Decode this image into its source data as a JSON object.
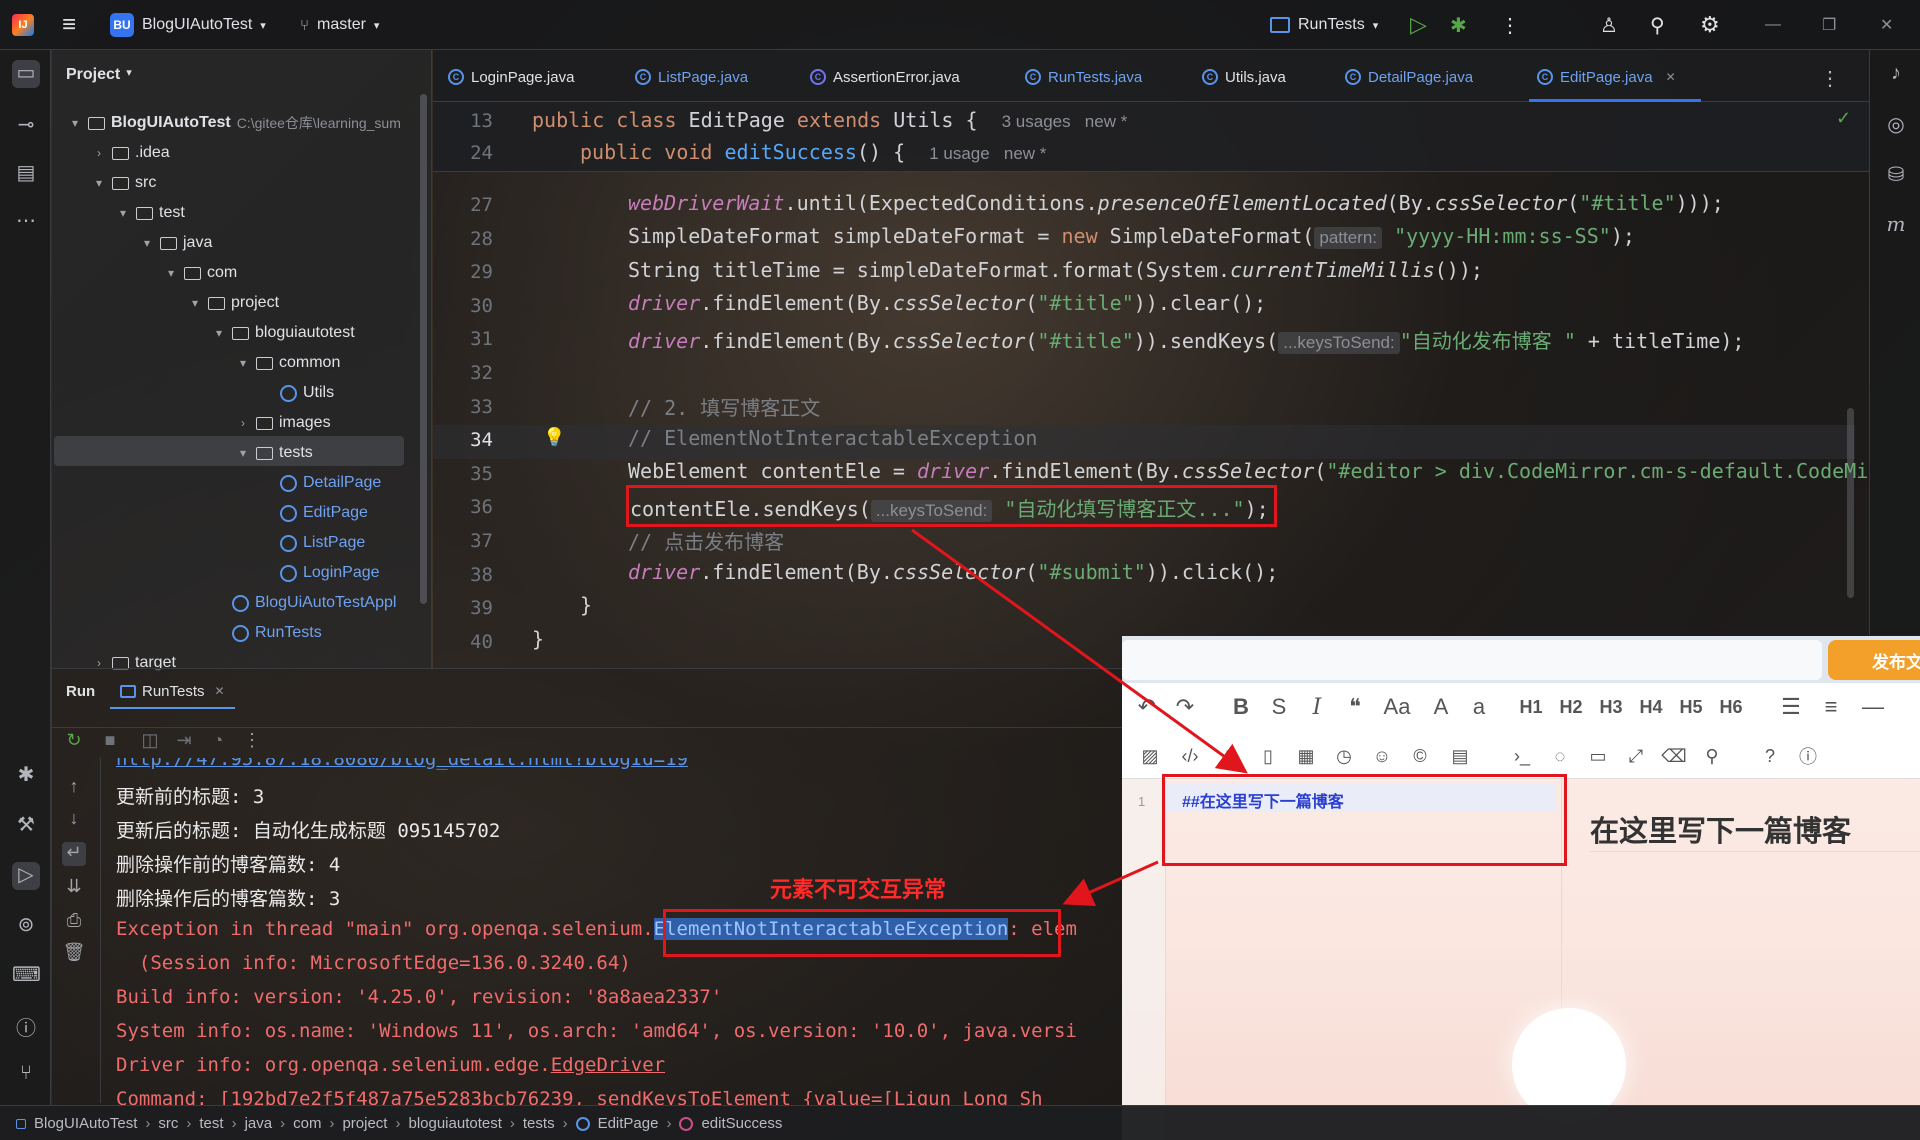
{
  "topbar": {
    "app_badge": "BU",
    "project": "BlogUIAutoTest",
    "branch": "master",
    "run_config": "RunTests"
  },
  "project_panel": {
    "title": "Project",
    "tree": [
      {
        "label": "BlogUIAutoTest",
        "path": "C:\\gitee仓库\\learning_sum",
        "kind": "folder"
      },
      {
        "label": ".idea",
        "kind": "folder"
      },
      {
        "label": "src",
        "kind": "folder"
      },
      {
        "label": "test",
        "kind": "folder"
      },
      {
        "label": "java",
        "kind": "folder"
      },
      {
        "label": "com",
        "kind": "folder"
      },
      {
        "label": "project",
        "kind": "folder"
      },
      {
        "label": "bloguiautotest",
        "kind": "folder"
      },
      {
        "label": "common",
        "kind": "folder"
      },
      {
        "label": "Utils",
        "kind": "class"
      },
      {
        "label": "images",
        "kind": "folder"
      },
      {
        "label": "tests",
        "kind": "folder"
      },
      {
        "label": "DetailPage",
        "kind": "class"
      },
      {
        "label": "EditPage",
        "kind": "class"
      },
      {
        "label": "ListPage",
        "kind": "class"
      },
      {
        "label": "LoginPage",
        "kind": "class"
      },
      {
        "label": "BlogUiAutoTestAppl",
        "kind": "class"
      },
      {
        "label": "RunTests",
        "kind": "class"
      },
      {
        "label": "target",
        "kind": "folder"
      }
    ]
  },
  "tabs": [
    "LoginPage.java",
    "ListPage.java",
    "AssertionError.java",
    "RunTests.java",
    "Utils.java",
    "DetailPage.java",
    "EditPage.java"
  ],
  "editor": {
    "sticky": [
      {
        "num": "13",
        "text": "public class EditPage extends Utils {",
        "hint": "3 usages   new *"
      },
      {
        "num": "24",
        "text": "public void editSuccess() {",
        "hint": "1 usage   new *"
      }
    ],
    "lines": [
      {
        "num": "27"
      },
      {
        "num": "28"
      },
      {
        "num": "29"
      },
      {
        "num": "30"
      },
      {
        "num": "31"
      },
      {
        "num": "32"
      },
      {
        "num": "33"
      },
      {
        "num": "34"
      },
      {
        "num": "35"
      },
      {
        "num": "36"
      },
      {
        "num": "37"
      },
      {
        "num": "38"
      },
      {
        "num": "39"
      },
      {
        "num": "40"
      }
    ],
    "code": {
      "l27a": "webDriverWait",
      "l27b": ".until(ExpectedConditions.",
      "l27c": "presenceOfElementLocated",
      "l27d": "(By.",
      "l27e": "cssSelector",
      "l27f": "(",
      "l27g": "\"#title\"",
      "l27h": ")));",
      "l28a": "SimpleDateFormat simpleDateFormat = ",
      "l28b": "new",
      "l28c": " SimpleDateFormat(",
      "l28hint": "pattern:",
      "l28d": "\"yyyy-HH:mm:ss-SS\"",
      "l28e": ");",
      "l29a": "String titleTime = simpleDateFormat.format(System.",
      "l29b": "currentTimeMillis",
      "l29c": "());",
      "l30a": "driver",
      "l30b": ".findElement(By.",
      "l30c": "cssSelector",
      "l30d": "(",
      "l30e": "\"#title\"",
      "l30f": ")).clear();",
      "l31a": "driver",
      "l31b": ".findElement(By.",
      "l31c": "cssSelector",
      "l31d": "(",
      "l31e": "\"#title\"",
      "l31f": ")).sendKeys(",
      "l31hint": "...keysToSend:",
      "l31g": "\"自动化发布博客 \"",
      "l31h": " + titleTime);",
      "l33": "// 2. 填写博客正文",
      "l34": "// ElementNotInteractableException",
      "l35a": "WebElement contentEle = ",
      "l35b": "driver",
      "l35c": ".findElement(By.",
      "l35d": "cssSelector",
      "l35e": "(",
      "l35f": "\"#editor > div.CodeMirror.cm-s-default.CodeMi",
      "l36a": "contentEle.sendKeys(",
      "l36hint": "...keysToSend:",
      "l36b": "\"自动化填写博客正文...\"",
      "l36c": ");",
      "l37": "// 点击发布博客",
      "l38a": "driver",
      "l38b": ".findElement(By.",
      "l38c": "cssSelector",
      "l38d": "(",
      "l38e": "\"#submit\"",
      "l38f": ")).click();",
      "l39": "}",
      "l40": "}"
    }
  },
  "run": {
    "tab_run": "Run",
    "tab_config": "RunTests",
    "output": {
      "url": "http://47.95.87.18:8080/blog_detail.html?blogId=19",
      "o1": "更新前的标题: 3",
      "o2": "更新后的标题: 自动化生成标题 095145702",
      "o3": "删除操作前的博客篇数: 4",
      "o4": "删除操作后的博客篇数: 3",
      "e1a": "Exception in thread \"main\" org.openqa.seleniu",
      "e1b": "m.",
      "e1c": "ElementNotInteractableException",
      "e1d": ": elem",
      "e2": "  (Session info: MicrosoftEdge=136.0.3240.64)",
      "e3": "Build info: version: '4.25.0', revision: '8a8aea2337'",
      "e4": "System info: os.name: 'Windows 11', os.arch: 'amd64', os.version: '10.0', java.versi",
      "e5a": "Driver info: org.openqa.selenium.edge.",
      "e5b": "EdgeDriver",
      "e6": "Command: [192bd7e2f5f487a75e5283bcb76239, sendKeysToElement {value=[Liqun Long Sh"
    },
    "annotation": "元素不可交互异常"
  },
  "blog_editor": {
    "publish": "发布文",
    "toolbar_row1": [
      "↶",
      "↷",
      "B",
      "S",
      "I",
      "❝",
      "Aa",
      "A",
      "a",
      "H1",
      "H2",
      "H3",
      "H4",
      "H5",
      "H6",
      "☰",
      "≡",
      "—"
    ],
    "line_number": "1",
    "source_line": "##在这里写下一篇博客",
    "preview_heading": "在这里写下一篇博客"
  },
  "statusbar": {
    "crumbs": [
      "BlogUIAutoTest",
      "src",
      "test",
      "java",
      "com",
      "project",
      "bloguiautotest",
      "tests",
      "EditPage",
      "editSuccess"
    ]
  },
  "colors": {
    "accent": "#5994e7",
    "error": "#f06c6c",
    "annotation": "#e0161c",
    "string": "#6aab73",
    "keyword": "#cf8e6d"
  }
}
